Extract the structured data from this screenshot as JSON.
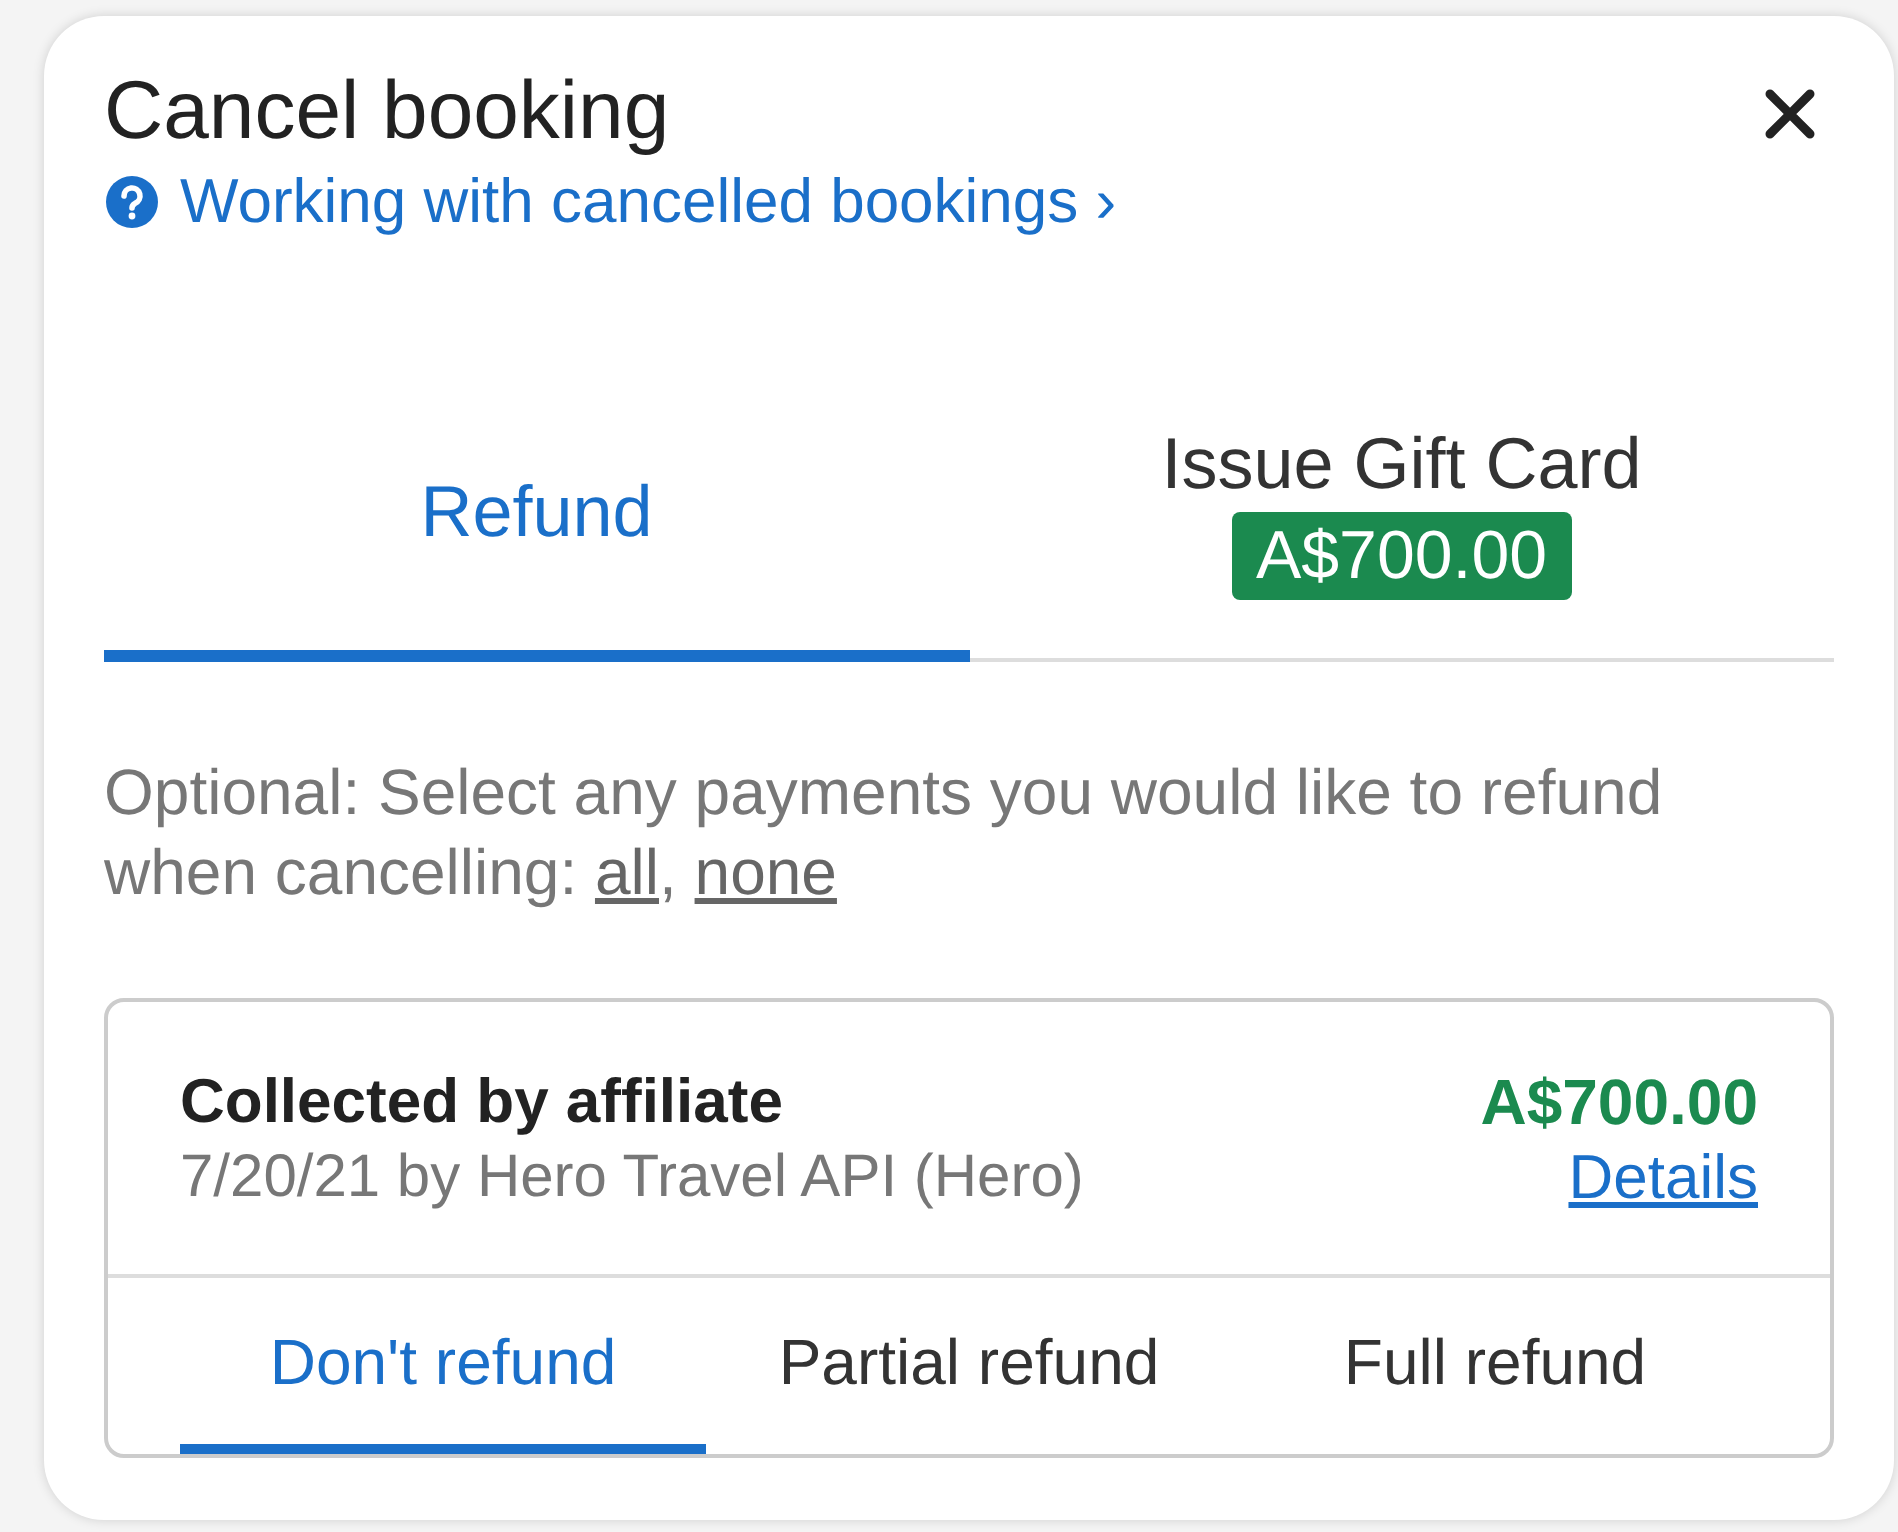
{
  "dialog": {
    "title": "Cancel booking",
    "help_link": "Working with cancelled bookings ›"
  },
  "tabs": [
    {
      "label": "Refund",
      "selected": true
    },
    {
      "label": "Issue Gift Card",
      "selected": false,
      "badge": "A$700.00"
    }
  ],
  "instructions": {
    "text": "Optional: Select any payments you would like to refund when cancelling:",
    "links": [
      "all",
      "none"
    ],
    "link_separator": ","
  },
  "payments": [
    {
      "source": "Collected by affiliate",
      "meta": "7/20/21 by Hero Travel API (Hero)",
      "amount": "A$700.00",
      "details_link": "Details",
      "options": [
        {
          "label": "Don't refund",
          "selected": true
        },
        {
          "label": "Partial refund",
          "selected": false
        },
        {
          "label": "Full refund",
          "selected": false
        }
      ]
    }
  ]
}
